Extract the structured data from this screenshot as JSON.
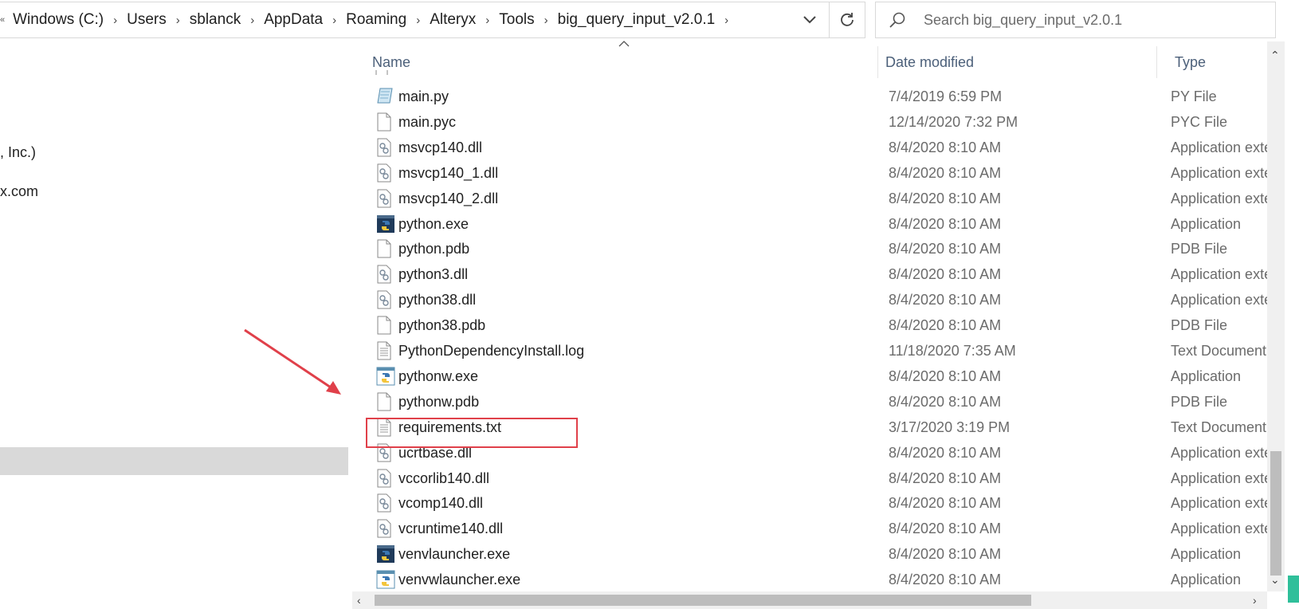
{
  "address_bar": {
    "lead_glyph": "«",
    "crumbs": [
      "Windows (C:)",
      "Users",
      "sblanck",
      "AppData",
      "Roaming",
      "Alteryx",
      "Tools",
      "big_query_input_v2.0.1"
    ]
  },
  "search": {
    "placeholder": "Search big_query_input_v2.0.1"
  },
  "nav_pane": {
    "fragments": [
      ", Inc.)",
      "x.com"
    ]
  },
  "columns": {
    "name": "Name",
    "date": "Date modified",
    "type": "Type"
  },
  "files": [
    {
      "name": "main.py",
      "date": "7/4/2019 6:59 PM",
      "type": "PY File",
      "icon": "python-script-icon"
    },
    {
      "name": "main.pyc",
      "date": "12/14/2020 7:32 PM",
      "type": "PYC File",
      "icon": "blank-file-icon"
    },
    {
      "name": "msvcp140.dll",
      "date": "8/4/2020 8:10 AM",
      "type": "Application exte",
      "icon": "dll-gear-icon"
    },
    {
      "name": "msvcp140_1.dll",
      "date": "8/4/2020 8:10 AM",
      "type": "Application exte",
      "icon": "dll-gear-icon"
    },
    {
      "name": "msvcp140_2.dll",
      "date": "8/4/2020 8:10 AM",
      "type": "Application exte",
      "icon": "dll-gear-icon"
    },
    {
      "name": "python.exe",
      "date": "8/4/2020 8:10 AM",
      "type": "Application",
      "icon": "python-console-icon"
    },
    {
      "name": "python.pdb",
      "date": "8/4/2020 8:10 AM",
      "type": "PDB File",
      "icon": "blank-file-icon"
    },
    {
      "name": "python3.dll",
      "date": "8/4/2020 8:10 AM",
      "type": "Application exte",
      "icon": "dll-gear-icon"
    },
    {
      "name": "python38.dll",
      "date": "8/4/2020 8:10 AM",
      "type": "Application exte",
      "icon": "dll-gear-icon"
    },
    {
      "name": "python38.pdb",
      "date": "8/4/2020 8:10 AM",
      "type": "PDB File",
      "icon": "blank-file-icon"
    },
    {
      "name": "PythonDependencyInstall.log",
      "date": "11/18/2020 7:35 AM",
      "type": "Text Document",
      "icon": "text-file-icon"
    },
    {
      "name": "pythonw.exe",
      "date": "8/4/2020 8:10 AM",
      "type": "Application",
      "icon": "python-window-icon"
    },
    {
      "name": "pythonw.pdb",
      "date": "8/4/2020 8:10 AM",
      "type": "PDB File",
      "icon": "blank-file-icon"
    },
    {
      "name": "requirements.txt",
      "date": "3/17/2020 3:19 PM",
      "type": "Text Document",
      "icon": "text-file-icon"
    },
    {
      "name": "ucrtbase.dll",
      "date": "8/4/2020 8:10 AM",
      "type": "Application exte",
      "icon": "dll-gear-icon"
    },
    {
      "name": "vccorlib140.dll",
      "date": "8/4/2020 8:10 AM",
      "type": "Application exte",
      "icon": "dll-gear-icon"
    },
    {
      "name": "vcomp140.dll",
      "date": "8/4/2020 8:10 AM",
      "type": "Application exte",
      "icon": "dll-gear-icon"
    },
    {
      "name": "vcruntime140.dll",
      "date": "8/4/2020 8:10 AM",
      "type": "Application exte",
      "icon": "dll-gear-icon"
    },
    {
      "name": "venvlauncher.exe",
      "date": "8/4/2020 8:10 AM",
      "type": "Application",
      "icon": "python-console-icon"
    },
    {
      "name": "venvwlauncher.exe",
      "date": "8/4/2020 8:10 AM",
      "type": "Application",
      "icon": "python-window-icon"
    }
  ],
  "colors": {
    "annotation_red": "#e0404a",
    "header_text": "#4c607a",
    "selection_gray": "#d9d9d9"
  }
}
